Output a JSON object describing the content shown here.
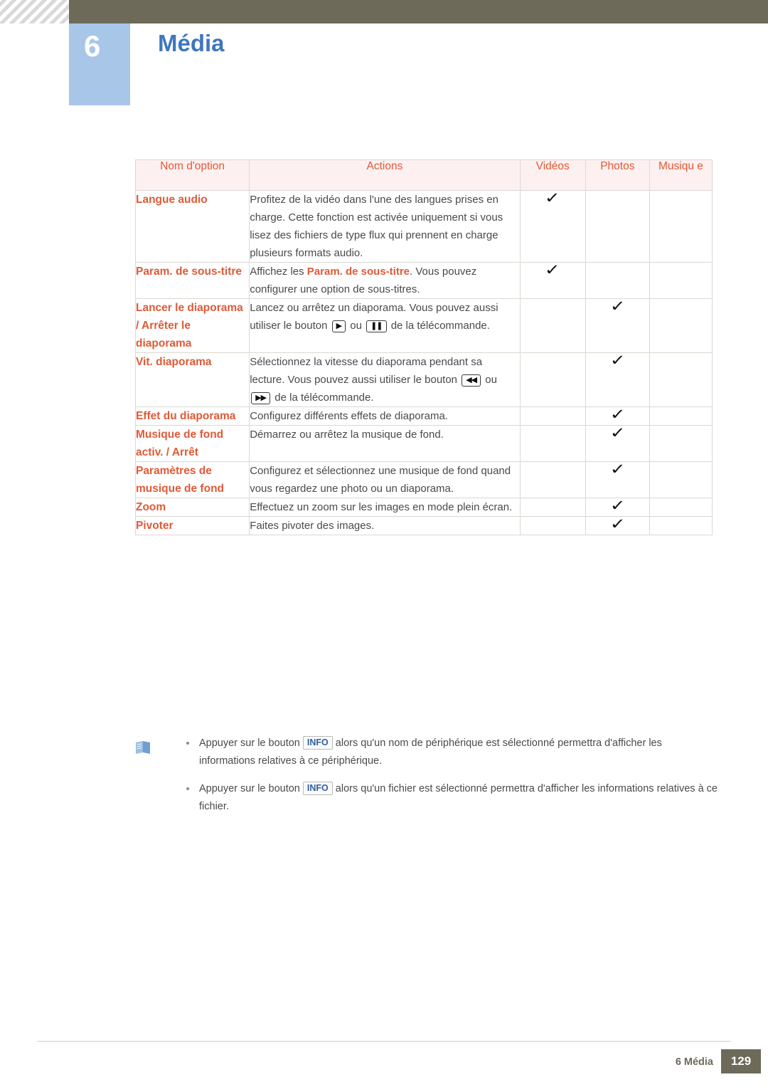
{
  "header": {
    "chapter_number": "6",
    "chapter_title": "Média"
  },
  "table": {
    "headers": {
      "name": "Nom d'option",
      "actions": "Actions",
      "videos": "Vidéos",
      "photos": "Photos",
      "musique": "Musiqu e"
    },
    "rows": [
      {
        "name": "Langue audio",
        "action": "Profitez de la vidéo dans l'une des langues prises en charge. Cette fonction est activée uniquement si vous lisez des fichiers de type flux qui prennent en charge plusieurs formats audio.",
        "videos": "✓",
        "photos": "",
        "musique": ""
      },
      {
        "name": "Param. de sous-titre",
        "action_pre": "Affichez les ",
        "action_hl": "Param. de sous-titre",
        "action_post": ". Vous pouvez configurer une option de sous-titres.",
        "videos": "✓",
        "photos": "",
        "musique": ""
      },
      {
        "name": "Lancer le diaporama / Arrêter le diaporama",
        "action_pre": "Lancez ou arrêtez un diaporama. Vous pouvez aussi utiliser le bouton ",
        "key1": "▶",
        "action_mid": " ou ",
        "key2": "❚❚",
        "action_post": " de la télécommande.",
        "videos": "",
        "photos": "✓",
        "musique": ""
      },
      {
        "name": "Vit. diaporama",
        "action_pre": "Sélectionnez la vitesse du diaporama pendant sa lecture. Vous pouvez aussi utiliser le bouton ",
        "key1": "◀◀",
        "action_mid": " ou ",
        "key2": "▶▶",
        "action_post": " de la télécommande.",
        "videos": "",
        "photos": "✓",
        "musique": ""
      },
      {
        "name": "Effet du diaporama",
        "action": "Configurez différents effets de diaporama.",
        "videos": "",
        "photos": "✓",
        "musique": ""
      },
      {
        "name": "Musique de fond activ. / Arrêt",
        "action": "Démarrez ou arrêtez la musique de fond.",
        "videos": "",
        "photos": "✓",
        "musique": ""
      },
      {
        "name": "Paramètres de musique de fond",
        "action": "Configurez et sélectionnez une musique de fond quand vous regardez une photo ou un diaporama.",
        "videos": "",
        "photos": "✓",
        "musique": ""
      },
      {
        "name": "Zoom",
        "action": "Effectuez un zoom sur les images en mode plein écran.",
        "videos": "",
        "photos": "✓",
        "musique": ""
      },
      {
        "name": "Pivoter",
        "action": "Faites pivoter des images.",
        "videos": "",
        "photos": "✓",
        "musique": ""
      }
    ]
  },
  "notes": [
    {
      "pre": "Appuyer sur le bouton ",
      "key": "INFO",
      "post": " alors qu'un nom de périphérique est sélectionné permettra d'afficher les informations relatives à ce périphérique."
    },
    {
      "pre": "Appuyer sur le bouton ",
      "key": "INFO",
      "post": " alors qu'un fichier est sélectionné permettra d'afficher les informations relatives à ce fichier."
    }
  ],
  "footer": {
    "label": "6 Média",
    "page": "129"
  }
}
